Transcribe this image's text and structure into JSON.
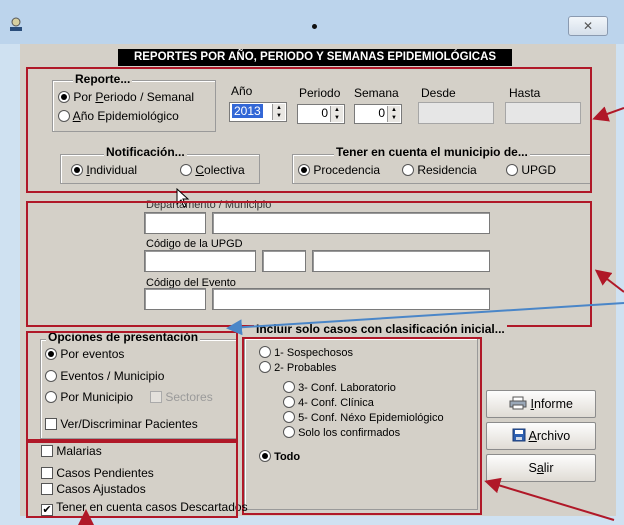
{
  "window": {
    "close_glyph": "✕"
  },
  "header": {
    "title": "REPORTES POR AÑO, PERIODO Y SEMANAS EPIDEMIOLÓGICAS"
  },
  "reporte": {
    "legend": "Reporte...",
    "options": [
      {
        "pre": "Por ",
        "ul": "P",
        "post": "eriodo / Semanal",
        "selected": true
      },
      {
        "pre": "",
        "ul": "A",
        "post": "ño Epidemiológico",
        "selected": false
      }
    ],
    "anio": {
      "label": "Año",
      "value": "2013"
    },
    "periodo": {
      "label": "Periodo",
      "value": "0"
    },
    "semana": {
      "label": "Semana",
      "value": "0"
    },
    "desde": {
      "label": "Desde",
      "value": ""
    },
    "hasta": {
      "label": "Hasta",
      "value": ""
    }
  },
  "notificacion": {
    "legend": "Notificación...",
    "options": [
      {
        "pre": "",
        "ul": "I",
        "post": "ndividual",
        "selected": true
      },
      {
        "pre": "",
        "ul": "C",
        "post": "olectiva",
        "selected": false
      }
    ]
  },
  "municipio": {
    "legend": "Tener en cuenta el municipio de...",
    "options": [
      {
        "label": "Procedencia",
        "selected": true
      },
      {
        "label": "Residencia",
        "selected": false
      },
      {
        "label": "UPGD",
        "selected": false
      }
    ]
  },
  "filtros": {
    "depto_label": "Departamento / Municipio",
    "upgd_label": "Código de la UPGD",
    "evento_label": "Código del Evento"
  },
  "presentacion": {
    "legend": "Opciones de presentación",
    "options": [
      {
        "label": "Por eventos",
        "selected": true
      },
      {
        "label": "Eventos / Municipio",
        "selected": false
      },
      {
        "label": "Por Municipio",
        "selected": false
      }
    ],
    "sectores_label": "Sectores",
    "ver_label": "Ver/Discriminar Pacientes"
  },
  "clasificacion": {
    "legend": "Incluir solo casos con clasificación inicial...",
    "options": [
      {
        "label": "1- Sospechosos",
        "selected": false
      },
      {
        "label": "2- Probables",
        "selected": false
      },
      {
        "label": "3- Conf. Laboratorio",
        "selected": false
      },
      {
        "label": "4- Conf. Clínica",
        "selected": false
      },
      {
        "label": "5- Conf. Néxo Epidemiológico",
        "selected": false
      },
      {
        "label": "Solo los confirmados",
        "selected": false
      },
      {
        "label": "Todo",
        "selected": true
      }
    ]
  },
  "checks": [
    {
      "label": "Malarias",
      "checked": false
    },
    {
      "label": "Casos Pendientes",
      "checked": false
    },
    {
      "label": "Casos Ajustados",
      "checked": false
    },
    {
      "label": "Tener en cuenta casos Descartados",
      "checked": true
    }
  ],
  "buttons": {
    "informe": {
      "ul": "I",
      "post": "nforme"
    },
    "archivo": {
      "ul": "A",
      "post": "rchivo"
    },
    "salir": {
      "pre": "S",
      "ul": "a",
      "post": "lir"
    }
  },
  "colors": {
    "annotation_red": "#b01828",
    "annotation_blue": "#4a86c8",
    "selected_year_bg": "#3367d6"
  }
}
